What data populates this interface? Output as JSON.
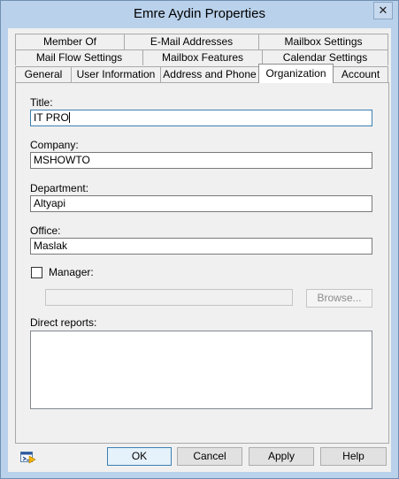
{
  "window": {
    "title": "Emre Aydin Properties",
    "close_glyph": "✕"
  },
  "tabs": {
    "row1": [
      "Member Of",
      "E-Mail Addresses",
      "Mailbox Settings"
    ],
    "row2": [
      "Mail Flow Settings",
      "Mailbox Features",
      "Calendar Settings"
    ],
    "row3": [
      "General",
      "User Information",
      "Address and Phone",
      "Organization",
      "Account"
    ],
    "active": "Organization"
  },
  "form": {
    "title_label": "Title:",
    "title_value": "IT PRO",
    "company_label": "Company:",
    "company_value": "MSHOWTO",
    "department_label": "Department:",
    "department_value": "Altyapi",
    "office_label": "Office:",
    "office_value": "Maslak",
    "manager_label": "Manager:",
    "manager_checked": false,
    "manager_value": "",
    "browse_label": "Browse...",
    "direct_reports_label": "Direct reports:"
  },
  "buttons": {
    "ok": "OK",
    "cancel": "Cancel",
    "apply": "Apply",
    "help": "Help"
  },
  "icons": {
    "help_icon": "exchange-shell-icon"
  },
  "colors": {
    "title_bar": "#b9d1ea",
    "dialog_bg": "#f0f0f0",
    "focus_border": "#3c7fb1"
  }
}
